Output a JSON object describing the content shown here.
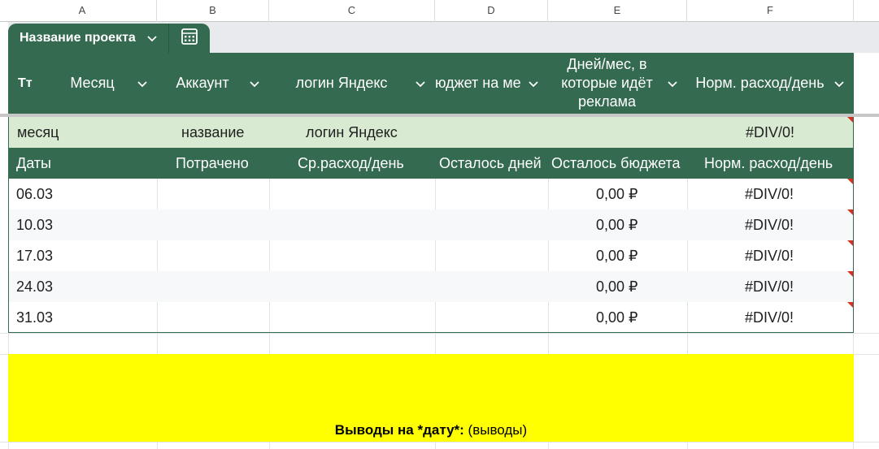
{
  "columns": [
    "A",
    "B",
    "C",
    "D",
    "E",
    "F"
  ],
  "table": {
    "name": "Название проекта",
    "headers": [
      {
        "label": "Тт"
      },
      {
        "label": "Месяц"
      },
      {
        "label": "Аккаунт"
      },
      {
        "label": "логин Яндекс"
      },
      {
        "label": "юджет на ме"
      },
      {
        "label": "Дней/мес, в которые идёт реклама"
      },
      {
        "label": "Норм. расход/день"
      }
    ]
  },
  "summary": {
    "month": "месяц",
    "name": "название",
    "login": "логин Яндекс",
    "norm": "#DIV/0!"
  },
  "subheader": {
    "dates": "Даты",
    "spent": "Потрачено",
    "avg": "Ср.расход/день",
    "days_left": "Осталось дней",
    "budget_left": "Осталось бюджета",
    "norm": "Норм. расход/день"
  },
  "rows": [
    {
      "date": "06.03",
      "budget_left": "0,00 ₽",
      "norm": "#DIV/0!"
    },
    {
      "date": "10.03",
      "budget_left": "0,00 ₽",
      "norm": "#DIV/0!"
    },
    {
      "date": "17.03",
      "budget_left": "0,00 ₽",
      "norm": "#DIV/0!"
    },
    {
      "date": "24.03",
      "budget_left": "0,00 ₽",
      "norm": "#DIV/0!"
    },
    {
      "date": "31.03",
      "budget_left": "0,00 ₽",
      "norm": "#DIV/0!"
    }
  ],
  "conclusion": {
    "label": "Выводы на *дату*:",
    "value": "(выводы)"
  },
  "colors": {
    "header_green": "#346a4f",
    "summary_green": "#d9ead3",
    "highlight_yellow": "#ffff00",
    "note_red": "#d93025"
  }
}
